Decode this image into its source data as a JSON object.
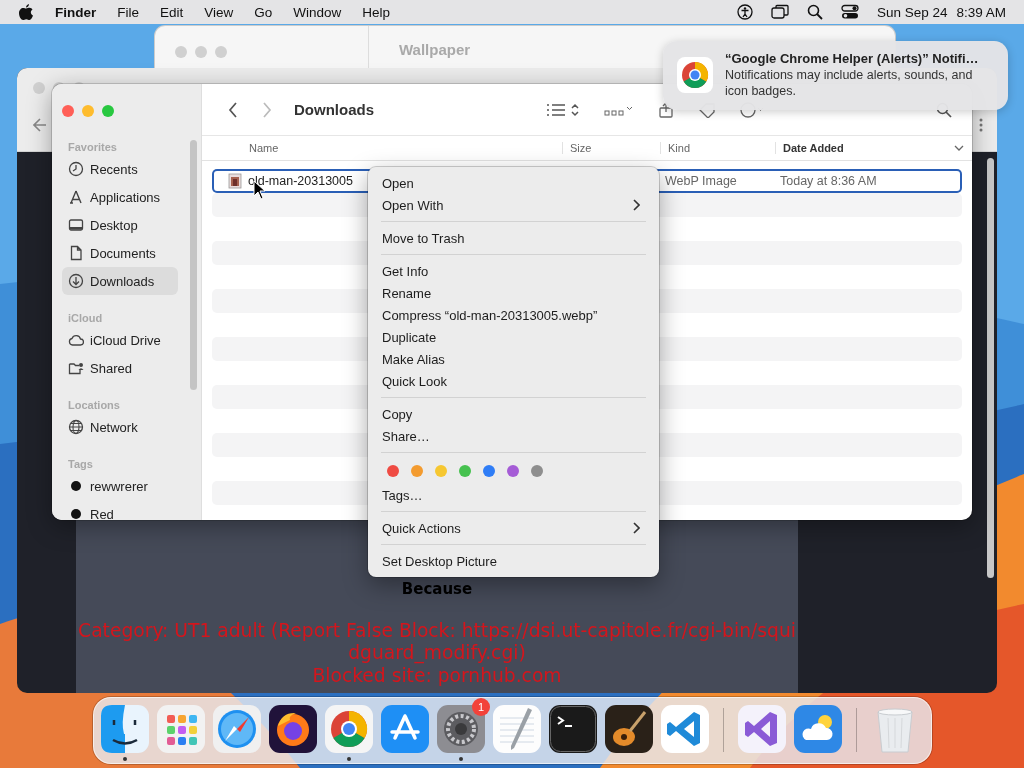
{
  "menubar": {
    "app": "Finder",
    "menus": [
      "File",
      "Edit",
      "View",
      "Go",
      "Window",
      "Help"
    ],
    "date": "Sun Sep 24",
    "time": "8:39 AM"
  },
  "background_window": {
    "title": "Wallpaper"
  },
  "browser_window": {
    "heading": "Because",
    "category": "Category: UT1 adult (Report False Block: https://dsi.ut-capitole.fr/cgi-bin/squidguard_modify.cgi)",
    "blocked": "Blocked site: pornhub.com"
  },
  "finder": {
    "title": "Downloads",
    "sidebar": [
      {
        "heading": "Favorites",
        "items": [
          {
            "label": "Recents",
            "selected": false
          },
          {
            "label": "Applications",
            "selected": false
          },
          {
            "label": "Desktop",
            "selected": false
          },
          {
            "label": "Documents",
            "selected": false
          },
          {
            "label": "Downloads",
            "selected": true
          }
        ]
      },
      {
        "heading": "iCloud",
        "items": [
          {
            "label": "iCloud Drive",
            "selected": false
          },
          {
            "label": "Shared",
            "selected": false
          }
        ]
      },
      {
        "heading": "Locations",
        "items": [
          {
            "label": "Network",
            "selected": false
          }
        ]
      },
      {
        "heading": "Tags",
        "items": [
          {
            "label": "rewwrerer",
            "color": "#111111",
            "selected": false
          },
          {
            "label": "Red",
            "color": "#111111",
            "selected": false
          }
        ]
      }
    ],
    "columns": [
      {
        "label": "Name",
        "sorted": false
      },
      {
        "label": "Size",
        "sorted": false
      },
      {
        "label": "Kind",
        "sorted": false
      },
      {
        "label": "Date Added",
        "sorted": true
      }
    ],
    "rows": [
      {
        "name": "old-man-20313005",
        "kind": "WebP Image",
        "date_added": "Today at 8:36 AM",
        "selected": true
      }
    ]
  },
  "context_menu": {
    "groups": [
      {
        "items": [
          {
            "label": "Open",
            "submenu": false
          },
          {
            "label": "Open With",
            "submenu": true
          }
        ]
      },
      {
        "items": [
          {
            "label": "Move to Trash",
            "submenu": false
          }
        ]
      },
      {
        "items": [
          {
            "label": "Get Info",
            "submenu": false
          },
          {
            "label": "Rename",
            "submenu": false
          },
          {
            "label": "Compress “old-man-20313005.webp”",
            "submenu": false
          },
          {
            "label": "Duplicate",
            "submenu": false
          },
          {
            "label": "Make Alias",
            "submenu": false
          },
          {
            "label": "Quick Look",
            "submenu": false
          }
        ]
      },
      {
        "items": [
          {
            "label": "Copy",
            "submenu": false
          },
          {
            "label": "Share…",
            "submenu": false
          }
        ]
      },
      {
        "tag_colors": [
          {
            "color": "#ef4b43"
          },
          {
            "color": "#f39b2f"
          },
          {
            "color": "#f6c731"
          },
          {
            "color": "#46c14f"
          },
          {
            "color": "#2f7df6"
          },
          {
            "color": "#a55cd6"
          },
          {
            "color": "#8e8e8e"
          }
        ],
        "items": [
          {
            "label": "Tags…",
            "submenu": false
          }
        ]
      },
      {
        "items": [
          {
            "label": "Quick Actions",
            "submenu": true
          }
        ]
      },
      {
        "items": [
          {
            "label": "Set Desktop Picture",
            "submenu": false
          }
        ]
      }
    ]
  },
  "notification": {
    "title": "“Google Chrome Helper (Alerts)” Notifi…",
    "body": "Notifications may include alerts, sounds, and icon badges."
  },
  "dock": {
    "sections": [
      {
        "items": [
          {
            "kind": "finder",
            "running": true
          },
          {
            "kind": "launchpad",
            "running": false
          },
          {
            "kind": "safari",
            "running": false
          },
          {
            "kind": "firefox",
            "running": false
          },
          {
            "kind": "chrome",
            "running": true
          },
          {
            "kind": "appstore",
            "running": false
          },
          {
            "kind": "settings",
            "running": true,
            "badge": "1"
          },
          {
            "kind": "textedit",
            "running": false
          },
          {
            "kind": "terminal",
            "running": false
          },
          {
            "kind": "garageband",
            "running": false
          },
          {
            "kind": "vscode",
            "running": false
          }
        ]
      },
      {
        "items": [
          {
            "kind": "visualstudio",
            "running": false
          },
          {
            "kind": "weather",
            "running": false
          }
        ]
      },
      {
        "items": [
          {
            "kind": "trash",
            "running": false
          }
        ]
      }
    ]
  }
}
